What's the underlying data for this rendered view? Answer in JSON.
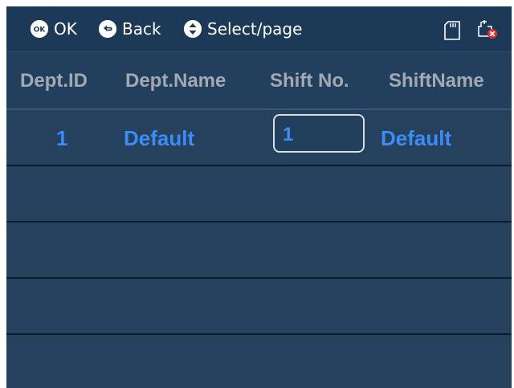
{
  "hints": {
    "ok_label": "OK",
    "ok_icon": "ok-icon",
    "back_label": "Back",
    "back_icon": "back-arrow-icon",
    "select_label": "Select/page",
    "select_icon": "up-down-arrow-icon"
  },
  "status_icons": {
    "sd": "sd-card-icon",
    "usb": "usb-disconnected-icon"
  },
  "table": {
    "columns": [
      "Dept.ID",
      "Dept.Name",
      "Shift No.",
      "ShiftName"
    ],
    "rows": [
      {
        "dept_id": "1",
        "dept_name": "Default",
        "shift_no": "1",
        "shift_name": "Default"
      }
    ]
  },
  "colors": {
    "background": "#1f3e5c",
    "value_text": "#3c8cf5",
    "header_text": "#a3a9b2"
  }
}
